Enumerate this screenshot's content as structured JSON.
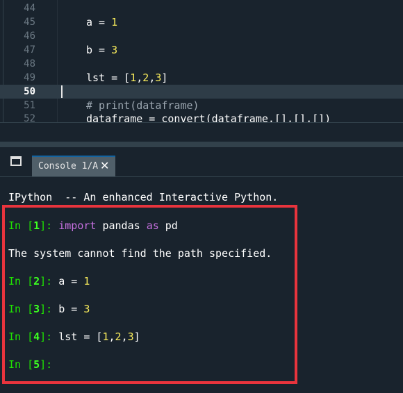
{
  "editor": {
    "lines": [
      {
        "num": "44",
        "code": ""
      },
      {
        "num": "45",
        "code": "a = 1"
      },
      {
        "num": "46",
        "code": ""
      },
      {
        "num": "47",
        "code": "b = 3"
      },
      {
        "num": "48",
        "code": ""
      },
      {
        "num": "49",
        "code": "lst = [1,2,3]"
      },
      {
        "num": "50",
        "code": ""
      },
      {
        "num": "51",
        "code": "# print(dataframe)"
      },
      {
        "num": "52",
        "code": "dataframe = convert(dataframe,[],[],[])"
      }
    ],
    "current_line": "50"
  },
  "console": {
    "tab_label": "Console 1/A",
    "banner": "IPython  -- An enhanced Interactive Python.",
    "entries": [
      {
        "prompt": "In [",
        "n": "1",
        "close": "]: ",
        "kw1": "import",
        "mid": " pandas ",
        "kw2": "as",
        "tail": " pd"
      },
      {
        "output": "The system cannot find the path specified."
      },
      {
        "prompt": "In [",
        "n": "2",
        "close": "]: ",
        "code": "a = ",
        "val": "1"
      },
      {
        "prompt": "In [",
        "n": "3",
        "close": "]: ",
        "code": "b = ",
        "val": "3"
      },
      {
        "prompt": "In [",
        "n": "4",
        "close": "]: ",
        "code": "lst = [",
        "vals": [
          "1",
          "2",
          "3"
        ],
        "end": "]"
      },
      {
        "prompt": "In [",
        "n": "5",
        "close": "]:"
      }
    ]
  },
  "colors": {
    "background": "#19232d",
    "prompt": "#1fe800",
    "keyword": "#c670e0",
    "number": "#faed5c",
    "highlight_box": "#e8343d",
    "tab_background": "#505f69"
  },
  "icons": {
    "window": "window-icon",
    "close": "close-icon"
  }
}
